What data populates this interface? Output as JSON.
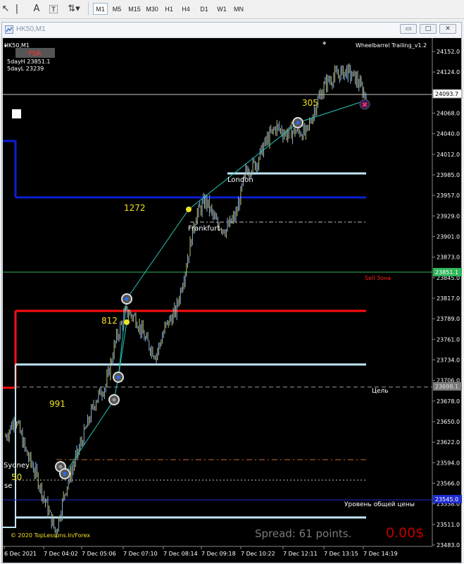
{
  "toolbar": {
    "timeframes": [
      "M1",
      "M5",
      "M15",
      "M30",
      "H1",
      "H4",
      "D1",
      "W1",
      "MN"
    ],
    "active_timeframe": "M1"
  },
  "window": {
    "title": "HK50,M1",
    "minimize_glyph": "▭",
    "maximize_glyph": "□",
    "close_glyph": "✕"
  },
  "chart": {
    "symbol_label": "HK50,M1",
    "indicator_name": "Wheelbarrel Trailing_v1.2",
    "indicator_icon_glyph": "◆",
    "fsr_label": "FSR",
    "day_high_label": "5dayH 23851.1",
    "day_low_label": "5dayL 23239",
    "sessions": {
      "london": "London",
      "frankfurt": "Frankfurt",
      "sydney": "Sydney"
    },
    "sydney_cut_label": "se",
    "sell_zone_label": "Sell Зона",
    "target_label": "Цель",
    "general_price_label": "Уровень общей цены",
    "copyright": "© 2020 TopLessons.In/Forex",
    "spread_text": "Spread: 61 points.",
    "profit_text": "0.00$",
    "wave_labels": [
      {
        "text": "305"
      },
      {
        "text": "1272"
      },
      {
        "text": "812"
      },
      {
        "text": "991"
      },
      {
        "text": "50"
      }
    ],
    "price_boxes": {
      "current": "24093.7",
      "day_high": "23851.1",
      "target": "23698.1",
      "blue_level": "23545.0"
    },
    "colors": {
      "background": "#000000",
      "candles": "#8fb2d6",
      "day_high_line": "#2fb55a",
      "red_level": "#ff1010",
      "blue_level": "#0b1fd6",
      "light_blue_level": "#bfe6f7",
      "zigzag": "#24c4b4",
      "wave_label": "#f0e226",
      "profit": "#c00000"
    }
  },
  "chart_data": {
    "type": "line",
    "y_tick_labels": [
      "24152.0",
      "24124.0",
      "24096.0",
      "24068.0",
      "24040.0",
      "24012.0",
      "23985.0",
      "23957.0",
      "23929.0",
      "23901.0",
      "23873.0",
      "23845.0",
      "23817.0",
      "23789.0",
      "23761.0",
      "23734.0",
      "23706.0",
      "23678.0",
      "23650.0",
      "23622.0",
      "23594.0",
      "23566.0",
      "23538.0",
      "23511.0",
      "23483.0"
    ],
    "x_tick_labels": [
      "6 Dec 2021",
      "7 Dec 04:02",
      "7 Dec 05:06",
      "7 Dec 07:10",
      "7 Dec 08:14",
      "7 Dec 09:18",
      "7 Dec 10:22",
      "7 Dec 12:11",
      "7 Dec 13:15",
      "7 Dec 14:19"
    ],
    "ylim": [
      23483,
      24152
    ],
    "series": [
      {
        "values": [
          23630,
          23655,
          23610,
          23580,
          23540,
          23500,
          23560,
          23600,
          23640,
          23680,
          23700,
          23760,
          23800,
          23790,
          23760,
          23740,
          23780,
          23800,
          23860,
          23930,
          23950,
          23920,
          23910,
          23930,
          23990,
          24000,
          24030,
          24050,
          24040,
          24045,
          24040,
          24080,
          24110,
          24120,
          24125,
          24115,
          24090
        ]
      }
    ],
    "levels": [
      {
        "name": "Sell Зона",
        "value": 23851.1
      },
      {
        "name": "Цель",
        "value": 23698.1
      },
      {
        "name": "Уровень общей цены",
        "value": 23545.0
      }
    ]
  }
}
